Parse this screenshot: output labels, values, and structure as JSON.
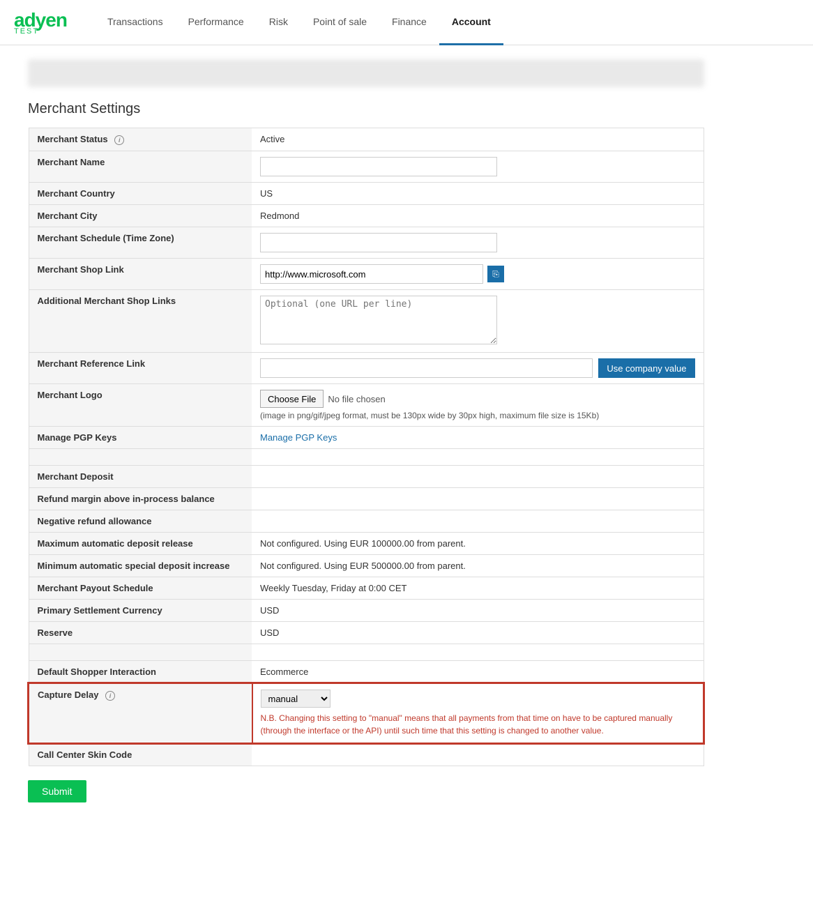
{
  "nav": {
    "logo": "adyen",
    "logo_sub": "TEST",
    "links": [
      {
        "label": "Transactions",
        "active": false,
        "name": "transactions"
      },
      {
        "label": "Performance",
        "active": false,
        "name": "performance"
      },
      {
        "label": "Risk",
        "active": false,
        "name": "risk"
      },
      {
        "label": "Point of sale",
        "active": false,
        "name": "point-of-sale"
      },
      {
        "label": "Finance",
        "active": false,
        "name": "finance"
      },
      {
        "label": "Account",
        "active": true,
        "name": "account"
      }
    ]
  },
  "page": {
    "title": "Merchant Settings"
  },
  "fields": {
    "merchant_status_label": "Merchant Status",
    "merchant_status_value": "Active",
    "merchant_name_label": "Merchant Name",
    "merchant_country_label": "Merchant Country",
    "merchant_country_value": "US",
    "merchant_city_label": "Merchant City",
    "merchant_city_value": "Redmond",
    "merchant_schedule_label": "Merchant Schedule (Time Zone)",
    "merchant_shop_link_label": "Merchant Shop Link",
    "merchant_shop_link_value": "http://www.microsoft.com",
    "additional_shop_links_label": "Additional Merchant Shop Links",
    "additional_shop_links_placeholder": "Optional (one URL per line)",
    "merchant_ref_link_label": "Merchant Reference Link",
    "use_company_value_label": "Use company value",
    "merchant_logo_label": "Merchant Logo",
    "choose_file_label": "Choose File",
    "no_file_label": "No file chosen",
    "file_hint": "(image in png/gif/jpeg format, must be 130px wide by 30px high, maximum file size is 15Kb)",
    "manage_pgp_label": "Manage PGP Keys",
    "manage_pgp_link_label": "Manage PGP Keys",
    "merchant_deposit_label": "Merchant Deposit",
    "refund_margin_label": "Refund margin above in-process balance",
    "negative_refund_label": "Negative refund allowance",
    "max_auto_deposit_label": "Maximum automatic deposit release",
    "max_auto_deposit_value": "Not configured. Using EUR 100000.00 from parent.",
    "min_auto_special_label": "Minimum automatic special deposit increase",
    "min_auto_special_value": "Not configured. Using EUR 500000.00 from parent.",
    "merchant_payout_label": "Merchant Payout Schedule",
    "merchant_payout_value": "Weekly Tuesday, Friday at 0:00 CET",
    "primary_settlement_label": "Primary Settlement Currency",
    "primary_settlement_value": "USD",
    "reserve_label": "Reserve",
    "reserve_value": "USD",
    "default_shopper_label": "Default Shopper Interaction",
    "default_shopper_value": "Ecommerce",
    "capture_delay_label": "Capture Delay",
    "capture_delay_value": "manual",
    "capture_note": "N.B. Changing this setting to \"manual\" means that all payments from that time on have to be captured manually (through the interface or the API) until such time that this setting is changed to another value.",
    "call_center_label": "Call Center Skin Code",
    "submit_label": "Submit"
  }
}
